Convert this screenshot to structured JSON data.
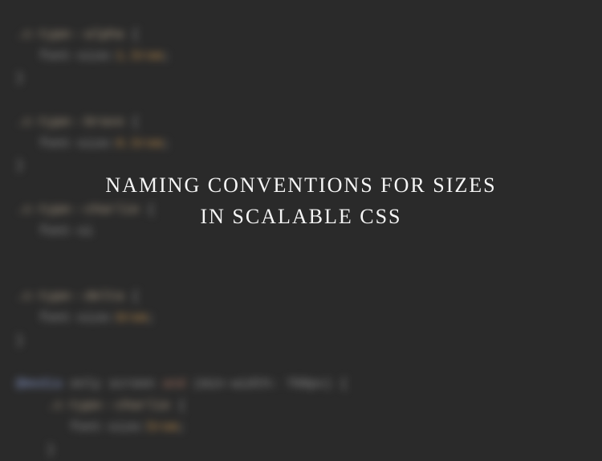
{
  "title": {
    "line1": "NAMING CONVENTIONS FOR SIZES",
    "line2": "IN SCALABLE CSS"
  },
  "code": {
    "block1": {
      "selector": ".c-type--alpha",
      "property": "font-size",
      "value": "1.5rem"
    },
    "block2": {
      "selector": ".c-type--bravo",
      "property": "font-size",
      "value": "0.5rem"
    },
    "block3": {
      "selector": ".c-type--charlie",
      "property": "font-si"
    },
    "block4": {
      "selector": ".c-type--delta",
      "property": "font-size",
      "value": "6rem"
    },
    "media": {
      "keyword1": "@media",
      "screen": "only screen",
      "keyword2": "and",
      "condition": "(min-width: 768px)",
      "inner_selector": ".c-type--charlie",
      "inner_property": "font-size",
      "inner_value": "5rem"
    }
  }
}
